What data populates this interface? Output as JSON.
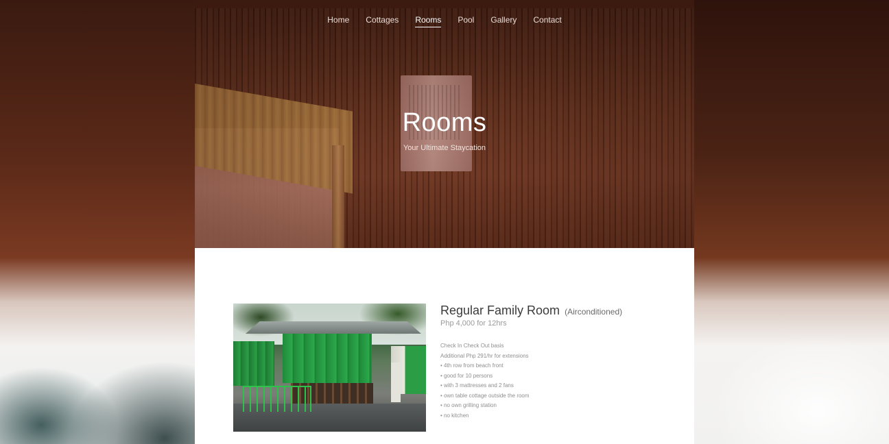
{
  "nav": {
    "items": [
      {
        "label": "Home"
      },
      {
        "label": "Cottages"
      },
      {
        "label": "Rooms"
      },
      {
        "label": "Pool"
      },
      {
        "label": "Gallery"
      },
      {
        "label": "Contact"
      }
    ],
    "active": "Rooms"
  },
  "hero": {
    "title": "Rooms",
    "subtitle": "Your Ultimate Staycation"
  },
  "room": {
    "name": "Regular Family Room",
    "note": "(Airconditioned)",
    "price": "Php 4,000 for 12hrs",
    "details": [
      "Check In Check Out basis",
      "Additional Php 291/hr for extensions",
      "• 4th row from beach front",
      "• good for 10 persons",
      "• with 3 mattresses and 2 fans",
      "• own table cottage outside the room",
      "• no own grilling station",
      "• no kitchen"
    ]
  },
  "colors": {
    "hero_bg": "#5a2a19",
    "page_bg": "#ffffff",
    "title_text": "#3a3a3a",
    "muted_text": "#8e8e8e"
  }
}
